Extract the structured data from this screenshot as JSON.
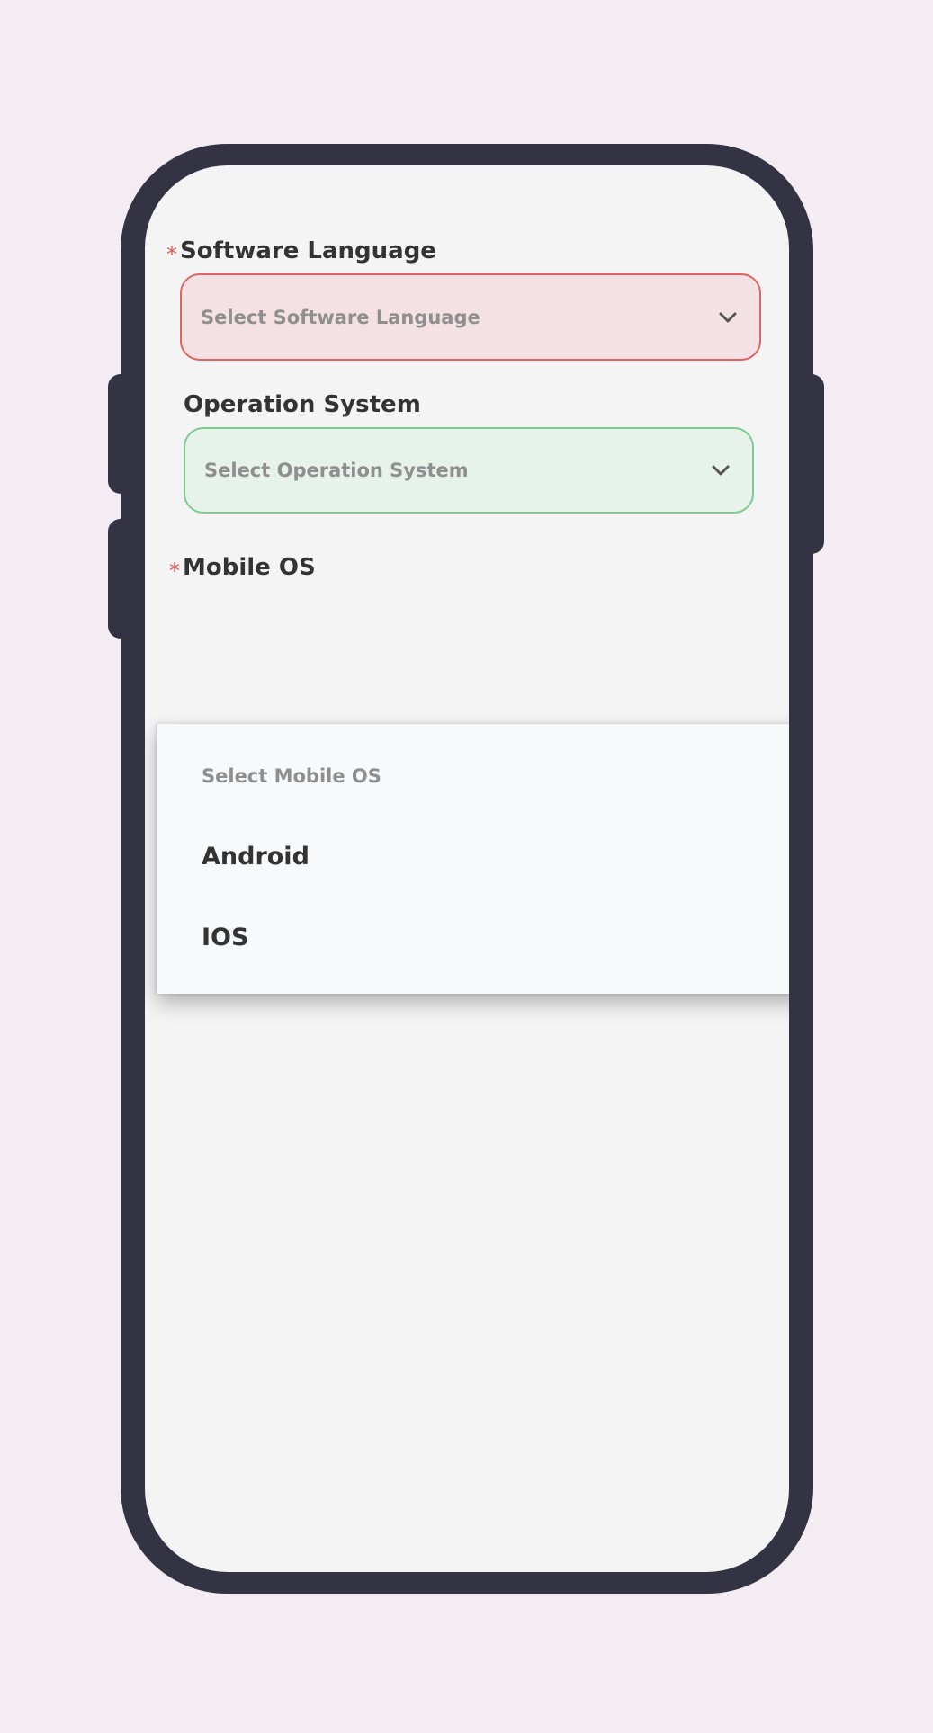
{
  "form": {
    "software_language": {
      "label": "Software Language",
      "required_mark": "*",
      "placeholder": "Select Software Language",
      "border_color": "#e06464",
      "background_color": "#f4e1e3"
    },
    "operation_system": {
      "label": "Operation System",
      "placeholder": "Select Operation System",
      "border_color": "#7dcb8d",
      "background_color": "#e7f2ea"
    },
    "mobile_os": {
      "label": "Mobile OS",
      "required_mark": "*",
      "dropdown": {
        "placeholder": "Select Mobile OS",
        "options": [
          "Android",
          "IOS"
        ]
      }
    }
  },
  "icons": {
    "dropdown_indicator": "chevron-down-icon"
  },
  "colors": {
    "page_background": "#f4ecf3",
    "phone_frame": "#343343",
    "screen_background": "#f4f4f5",
    "required_mark": "#e15a5a",
    "text_primary": "#333333",
    "text_placeholder": "#8f8f8f"
  }
}
